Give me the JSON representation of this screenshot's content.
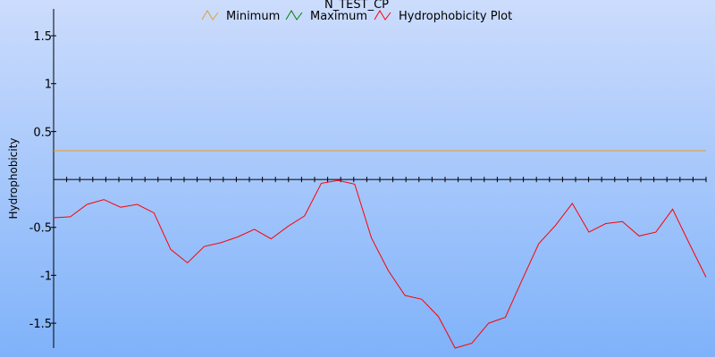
{
  "chart_data": {
    "type": "line",
    "title": "N_TEST_CP",
    "xlabel": "",
    "ylabel": "Hydrophobicity",
    "ylim": [
      -1.76,
      1.78
    ],
    "xlim": [
      0,
      51
    ],
    "yticks": [
      {
        "value": 1.5,
        "label": "1.5"
      },
      {
        "value": 1,
        "label": "1"
      },
      {
        "value": 0.5,
        "label": "0.5"
      },
      {
        "value": -0.5,
        "label": "-0.5"
      },
      {
        "value": -1,
        "label": "-1"
      },
      {
        "value": -1.5,
        "label": "-1.5"
      }
    ],
    "x_tick_count": 51,
    "grid": false,
    "legend_position": "top",
    "series": [
      {
        "name": "Minimum",
        "color": "#e0a030",
        "values": [
          0.3,
          0.3
        ]
      },
      {
        "name": "Maximum",
        "color": "#008000",
        "values": []
      },
      {
        "name": "Hydrophobicity Plot",
        "color": "#ff0000",
        "values": [
          -0.4,
          -0.39,
          -0.26,
          -0.21,
          -0.29,
          -0.26,
          -0.35,
          -0.73,
          -0.87,
          -0.7,
          -0.66,
          -0.6,
          -0.52,
          -0.62,
          -0.49,
          -0.38,
          -0.04,
          -0.01,
          -0.05,
          -0.61,
          -0.95,
          -1.21,
          -1.25,
          -1.43,
          -1.76,
          -1.71,
          -1.5,
          -1.44,
          -1.05,
          -0.67,
          -0.48,
          -0.25,
          -0.55,
          -0.46,
          -0.44,
          -0.59,
          -0.55,
          -0.31,
          -0.67,
          -1.02
        ]
      }
    ]
  }
}
